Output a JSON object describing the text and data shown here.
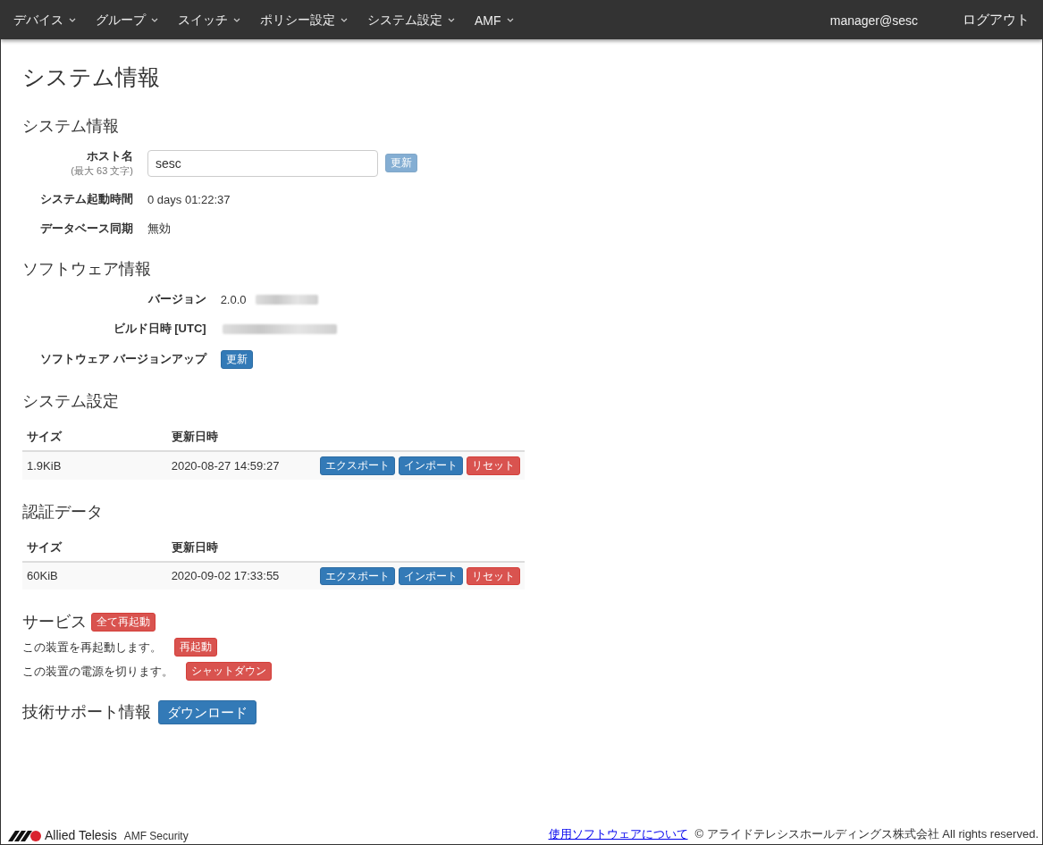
{
  "navbar": {
    "menus": [
      {
        "label": "デバイス"
      },
      {
        "label": "グループ"
      },
      {
        "label": "スイッチ"
      },
      {
        "label": "ポリシー設定"
      },
      {
        "label": "システム設定"
      },
      {
        "label": "AMF"
      }
    ],
    "user": "manager@sesc",
    "logout": "ログアウト"
  },
  "page_title": "システム情報",
  "sections": [
    {
      "kind": "form",
      "title": "システム情報",
      "rows": [
        {
          "kind": "input",
          "label": "ホスト名",
          "hint": "(最大 63 文字)",
          "value": "sesc",
          "button": {
            "label": "更新",
            "kind": "primary",
            "disabled": true
          }
        },
        {
          "kind": "text",
          "label": "システム起動時間",
          "value": "0 days 01:22:37"
        },
        {
          "kind": "text",
          "label": "データベース同期",
          "value": "無効"
        }
      ]
    },
    {
      "kind": "form",
      "title": "ソフトウェア情報",
      "rows": [
        {
          "kind": "text",
          "label": "バージョン",
          "value": "2.0.0",
          "redacted": true
        },
        {
          "kind": "text",
          "label": "ビルド日時 [UTC]",
          "redacted": true
        },
        {
          "kind": "button",
          "label": "ソフトウェア バージョンアップ",
          "button": {
            "label": "更新",
            "kind": "primary",
            "disabled": false
          }
        }
      ]
    },
    {
      "kind": "table",
      "title": "システム設定",
      "columns": [
        "サイズ",
        "更新日時"
      ],
      "rows": [
        {
          "cells": [
            "1.9KiB",
            "2020-08-27 14:59:27"
          ],
          "actions": [
            {
              "label": "エクスポート",
              "kind": "primary"
            },
            {
              "label": "インポート",
              "kind": "primary"
            },
            {
              "label": "リセット",
              "kind": "danger"
            }
          ]
        }
      ]
    },
    {
      "kind": "table",
      "title": "認証データ",
      "columns": [
        "サイズ",
        "更新日時"
      ],
      "rows": [
        {
          "cells": [
            "60KiB",
            "2020-09-02 17:33:55"
          ],
          "actions": [
            {
              "label": "エクスポート",
              "kind": "primary"
            },
            {
              "label": "インポート",
              "kind": "primary"
            },
            {
              "label": "リセット",
              "kind": "danger"
            }
          ]
        }
      ]
    },
    {
      "kind": "service",
      "title": "サービス",
      "button": {
        "label": "全て再起動",
        "kind": "danger"
      },
      "items": [
        {
          "text": "この装置を再起動します。",
          "button": {
            "label": "再起動",
            "kind": "danger"
          }
        },
        {
          "text": "この装置の電源を切ります。",
          "button": {
            "label": "シャットダウン",
            "kind": "danger"
          }
        }
      ]
    },
    {
      "kind": "inline",
      "title": "技術サポート情報",
      "button": {
        "label": "ダウンロード",
        "kind": "primary"
      }
    }
  ],
  "footer": {
    "brand": "Allied Telesis",
    "product": "AMF Security",
    "link": "使用ソフトウェアについて",
    "copyright": "© アライドテレシスホールディングス株式会社 All rights reserved."
  }
}
